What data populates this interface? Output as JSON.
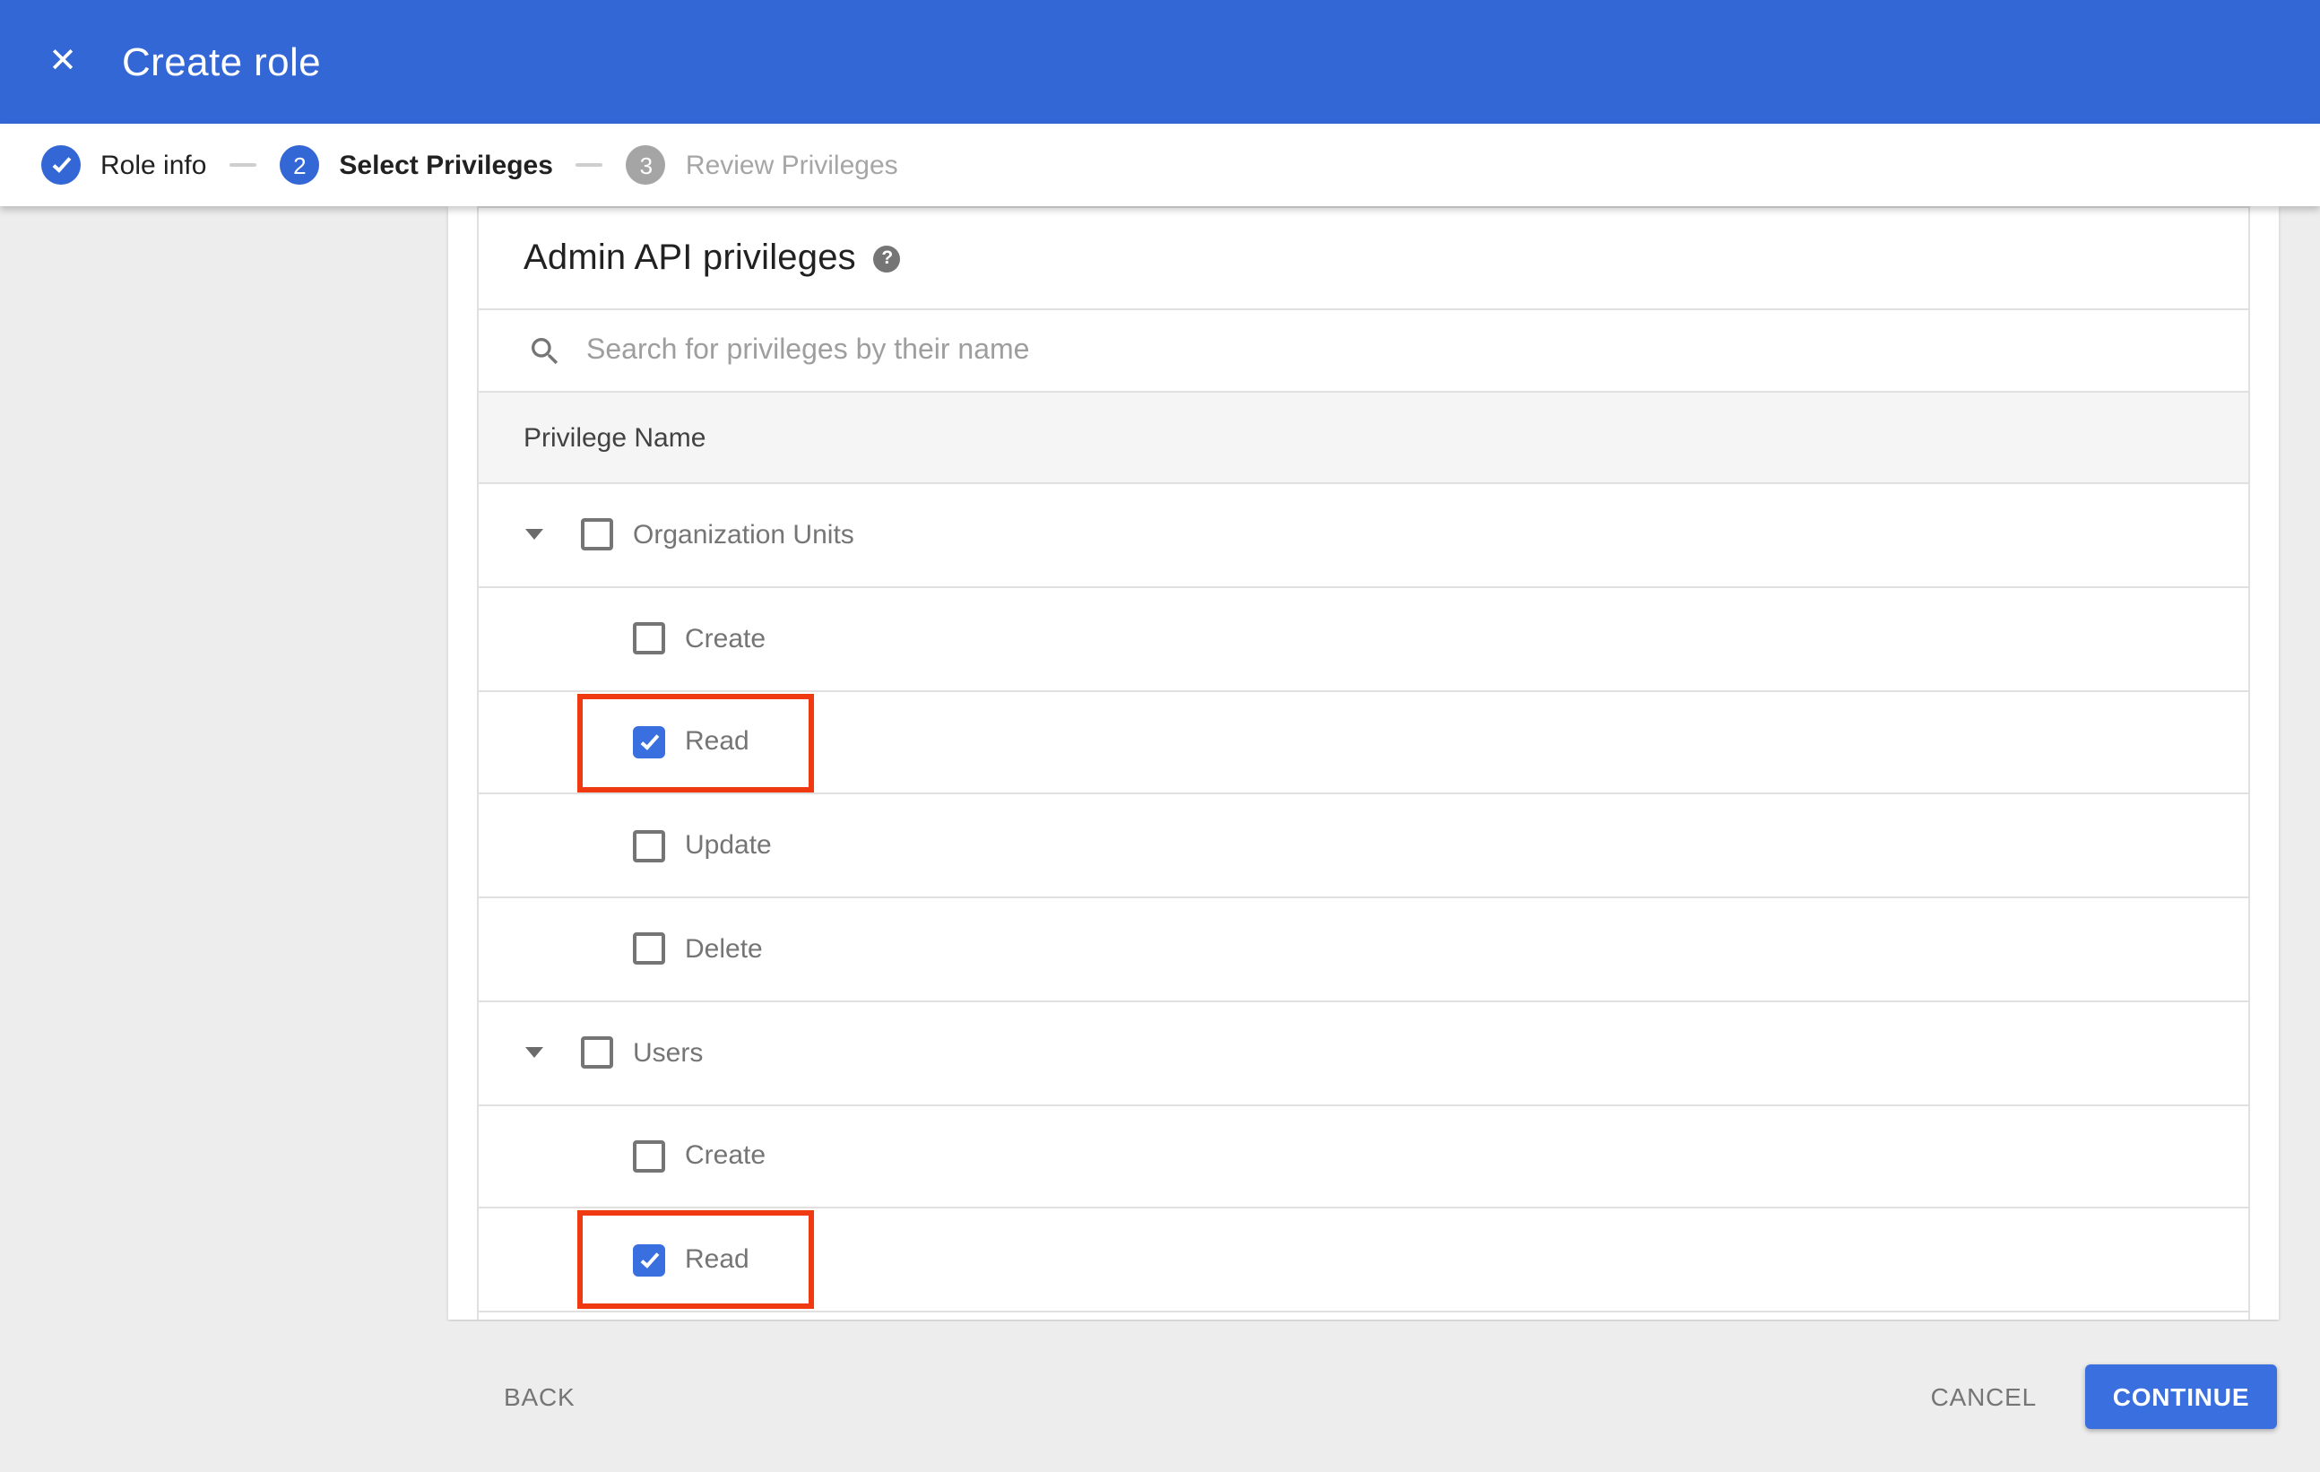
{
  "header": {
    "title": "Create role",
    "close_glyph": "✕"
  },
  "stepper": {
    "steps": [
      {
        "number": "1",
        "label": "Role info",
        "status": "complete"
      },
      {
        "number": "2",
        "label": "Select Privileges",
        "status": "active"
      },
      {
        "number": "3",
        "label": "Review Privileges",
        "status": "upcoming"
      }
    ]
  },
  "panel": {
    "heading": "Admin API privileges",
    "help_glyph": "?",
    "search_placeholder": "Search for privileges by their name",
    "column_header": "Privilege Name",
    "groups": [
      {
        "label": "Organization Units",
        "checked": false,
        "expanded": true,
        "children": [
          {
            "label": "Create",
            "checked": false,
            "highlighted": false
          },
          {
            "label": "Read",
            "checked": true,
            "highlighted": true
          },
          {
            "label": "Update",
            "checked": false,
            "highlighted": false
          },
          {
            "label": "Delete",
            "checked": false,
            "highlighted": false
          }
        ]
      },
      {
        "label": "Users",
        "checked": false,
        "expanded": true,
        "children": [
          {
            "label": "Create",
            "checked": false,
            "highlighted": false
          },
          {
            "label": "Read",
            "checked": true,
            "highlighted": true
          }
        ]
      }
    ]
  },
  "footer": {
    "back_label": "BACK",
    "cancel_label": "CANCEL",
    "continue_label": "CONTINUE"
  },
  "colors": {
    "header_blue": "#3367d6",
    "control_blue": "#3a6fe0",
    "page_gray": "#ededed",
    "row_border": "#e0e0e0",
    "table_header_bg": "#f5f5f5",
    "label_gray": "#757575",
    "step_inactive_gray": "#a5a5a5",
    "highlight_red": "#ee3911"
  }
}
